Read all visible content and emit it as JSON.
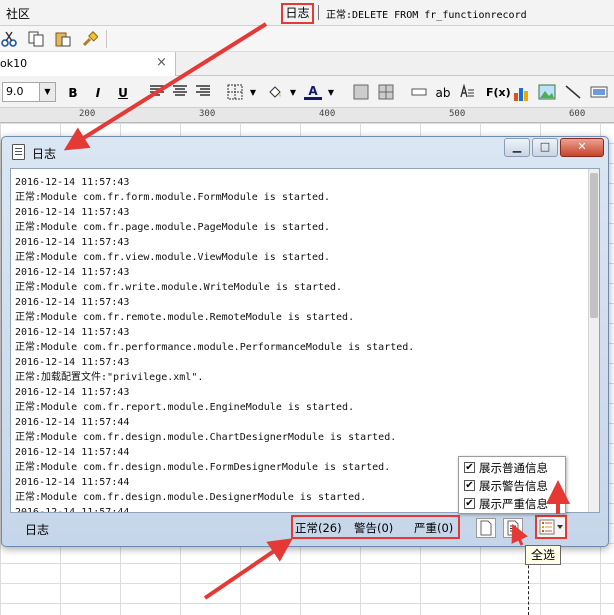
{
  "menubar": {
    "community": "社区",
    "log_button": "日志",
    "status_text": "正常:DELETE FROM fr_functionrecord"
  },
  "tab": {
    "label": "ok10",
    "close_symbol": "×"
  },
  "format_toolbar": {
    "font_size": "9.0",
    "bold": "B",
    "italic": "I",
    "underline": "U",
    "ab": "ab",
    "fx": "F(x)"
  },
  "ruler": {
    "ticks": [
      "200",
      "300",
      "400",
      "500",
      "600"
    ]
  },
  "dialog": {
    "title": "日志",
    "minimize": "▁",
    "maximize": "□",
    "close": "✕",
    "log_lines": [
      "2016-12-14 11:57:43",
      "正常:Module com.fr.form.module.FormModule is started.",
      "2016-12-14 11:57:43",
      "正常:Module com.fr.page.module.PageModule is started.",
      "2016-12-14 11:57:43",
      "正常:Module com.fr.view.module.ViewModule is started.",
      "2016-12-14 11:57:43",
      "正常:Module com.fr.write.module.WriteModule is started.",
      "2016-12-14 11:57:43",
      "正常:Module com.fr.remote.module.RemoteModule is started.",
      "2016-12-14 11:57:43",
      "正常:Module com.fr.performance.module.PerformanceModule is started.",
      "2016-12-14 11:57:43",
      "正常:加载配置文件:\"privilege.xml\".",
      "2016-12-14 11:57:43",
      "正常:Module com.fr.report.module.EngineModule is started.",
      "2016-12-14 11:57:44",
      "正常:Module com.fr.design.module.ChartDesignerModule is started.",
      "2016-12-14 11:57:44",
      "正常:Module com.fr.design.module.FormDesignerModule is started.",
      "2016-12-14 11:57:44",
      "正常:Module com.fr.design.module.DesignerModule is started.",
      "2016-12-14 11:57:44"
    ],
    "footer_label": "日志",
    "counts": {
      "normal": "正常(26)",
      "warning": "警告(0)",
      "severe": "严重(0)"
    },
    "popup": {
      "show_normal": "展示普通信息",
      "show_warning": "展示警告信息",
      "show_severe": "展示严重信息",
      "checked": "✔"
    },
    "tooltip": "全选"
  },
  "colors": {
    "highlight": "#e53935",
    "dialog_frame": "#c6d6ea"
  }
}
